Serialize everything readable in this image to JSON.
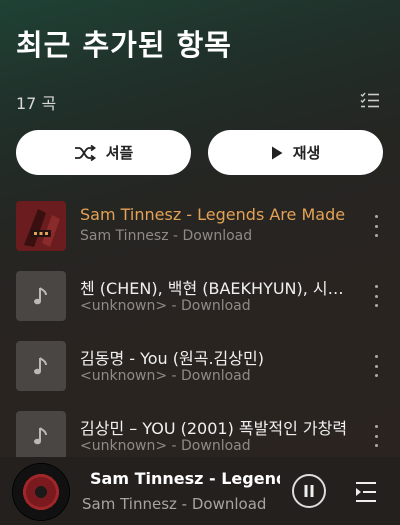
{
  "header": {
    "title": "최근 추가된 항목"
  },
  "summary": {
    "song_count": "17 곡"
  },
  "actions": {
    "shuffle_label": "셔플",
    "play_label": "재생"
  },
  "songs": [
    {
      "title": "Sam Tinnesz - Legends Are Made",
      "subtitle": "Sam Tinnesz - Download",
      "playing": true,
      "thumbnail": "album-art"
    },
    {
      "title": "첸 (CHEN), 백현 (BAEKHYUN), 시우민 (XIUMIN)",
      "subtitle": "<unknown> - Download",
      "playing": false,
      "thumbnail": "music-note-icon"
    },
    {
      "title": "김동명 - You (원곡.김상민)",
      "subtitle": "<unknown> - Download",
      "playing": false,
      "thumbnail": "music-note-icon"
    },
    {
      "title": "김상민 – YOU (2001)  폭발적인 가창력",
      "subtitle": "<unknown> - Download",
      "playing": false,
      "thumbnail": "music-note-icon"
    }
  ],
  "now_playing": {
    "title": "Sam Tinnesz - Legends",
    "subtitle": "Sam Tinnesz - Download",
    "state": "playing"
  },
  "colors": {
    "accent_playing": "#e5a256",
    "button_bg": "#ffffff",
    "subtitle": "#8f8a87"
  }
}
